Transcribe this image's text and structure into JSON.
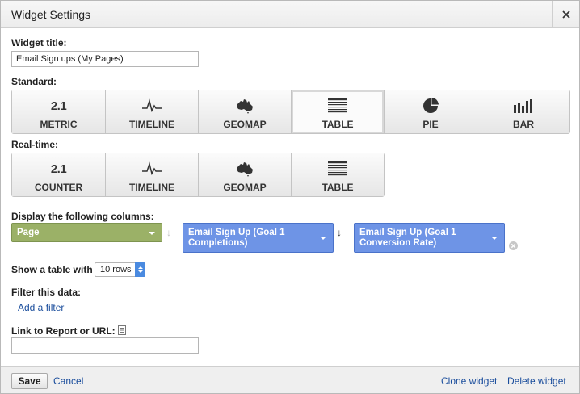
{
  "dialog": {
    "title": "Widget Settings"
  },
  "widget_title": {
    "label": "Widget title:",
    "value": "Email Sign ups (My Pages)"
  },
  "standard": {
    "label": "Standard:",
    "options": [
      {
        "icon_text": "2.1",
        "label": "METRIC"
      },
      {
        "icon": "timeline-icon",
        "label": "TIMELINE"
      },
      {
        "icon": "geomap-icon",
        "label": "GEOMAP"
      },
      {
        "icon": "table-icon",
        "label": "TABLE",
        "selected": true
      },
      {
        "icon": "pie-icon",
        "label": "PIE"
      },
      {
        "icon": "bar-icon",
        "label": "BAR"
      }
    ]
  },
  "realtime": {
    "label": "Real-time:",
    "options": [
      {
        "icon_text": "2.1",
        "label": "COUNTER"
      },
      {
        "icon": "timeline-icon",
        "label": "TIMELINE"
      },
      {
        "icon": "geomap-icon",
        "label": "GEOMAP"
      },
      {
        "icon": "table-icon",
        "label": "TABLE"
      }
    ]
  },
  "columns": {
    "label": "Display the following columns:",
    "items": [
      {
        "label": "Page"
      },
      {
        "label": "Email Sign Up (Goal 1 Completions)"
      },
      {
        "label": "Email Sign Up (Goal 1 Conversion Rate)"
      }
    ]
  },
  "show_table": {
    "label": "Show a table with",
    "rows_value": "10 rows"
  },
  "filter": {
    "label": "Filter this data:",
    "add_filter": "Add a filter"
  },
  "link_report": {
    "label": "Link to Report or URL:",
    "value": ""
  },
  "footer": {
    "save": "Save",
    "cancel": "Cancel",
    "clone": "Clone widget",
    "delete": "Delete widget"
  },
  "colors": {
    "page_column": "#9bb167",
    "metric_column": "#6e94e6",
    "link": "#1a4d9c"
  }
}
